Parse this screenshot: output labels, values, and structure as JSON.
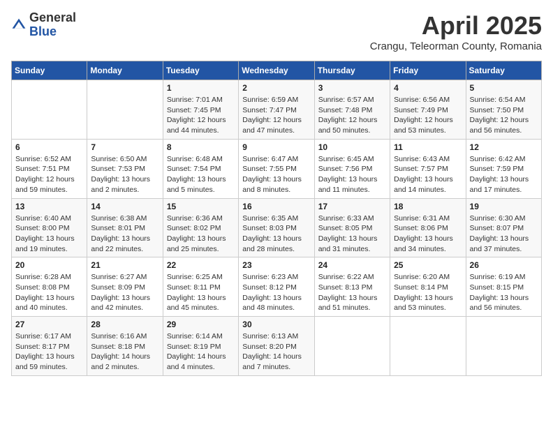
{
  "header": {
    "logo_general": "General",
    "logo_blue": "Blue",
    "month": "April 2025",
    "location": "Crangu, Teleorman County, Romania"
  },
  "weekdays": [
    "Sunday",
    "Monday",
    "Tuesday",
    "Wednesday",
    "Thursday",
    "Friday",
    "Saturday"
  ],
  "weeks": [
    [
      {
        "day": "",
        "info": ""
      },
      {
        "day": "",
        "info": ""
      },
      {
        "day": "1",
        "info": "Sunrise: 7:01 AM\nSunset: 7:45 PM\nDaylight: 12 hours and 44 minutes."
      },
      {
        "day": "2",
        "info": "Sunrise: 6:59 AM\nSunset: 7:47 PM\nDaylight: 12 hours and 47 minutes."
      },
      {
        "day": "3",
        "info": "Sunrise: 6:57 AM\nSunset: 7:48 PM\nDaylight: 12 hours and 50 minutes."
      },
      {
        "day": "4",
        "info": "Sunrise: 6:56 AM\nSunset: 7:49 PM\nDaylight: 12 hours and 53 minutes."
      },
      {
        "day": "5",
        "info": "Sunrise: 6:54 AM\nSunset: 7:50 PM\nDaylight: 12 hours and 56 minutes."
      }
    ],
    [
      {
        "day": "6",
        "info": "Sunrise: 6:52 AM\nSunset: 7:51 PM\nDaylight: 12 hours and 59 minutes."
      },
      {
        "day": "7",
        "info": "Sunrise: 6:50 AM\nSunset: 7:53 PM\nDaylight: 13 hours and 2 minutes."
      },
      {
        "day": "8",
        "info": "Sunrise: 6:48 AM\nSunset: 7:54 PM\nDaylight: 13 hours and 5 minutes."
      },
      {
        "day": "9",
        "info": "Sunrise: 6:47 AM\nSunset: 7:55 PM\nDaylight: 13 hours and 8 minutes."
      },
      {
        "day": "10",
        "info": "Sunrise: 6:45 AM\nSunset: 7:56 PM\nDaylight: 13 hours and 11 minutes."
      },
      {
        "day": "11",
        "info": "Sunrise: 6:43 AM\nSunset: 7:57 PM\nDaylight: 13 hours and 14 minutes."
      },
      {
        "day": "12",
        "info": "Sunrise: 6:42 AM\nSunset: 7:59 PM\nDaylight: 13 hours and 17 minutes."
      }
    ],
    [
      {
        "day": "13",
        "info": "Sunrise: 6:40 AM\nSunset: 8:00 PM\nDaylight: 13 hours and 19 minutes."
      },
      {
        "day": "14",
        "info": "Sunrise: 6:38 AM\nSunset: 8:01 PM\nDaylight: 13 hours and 22 minutes."
      },
      {
        "day": "15",
        "info": "Sunrise: 6:36 AM\nSunset: 8:02 PM\nDaylight: 13 hours and 25 minutes."
      },
      {
        "day": "16",
        "info": "Sunrise: 6:35 AM\nSunset: 8:03 PM\nDaylight: 13 hours and 28 minutes."
      },
      {
        "day": "17",
        "info": "Sunrise: 6:33 AM\nSunset: 8:05 PM\nDaylight: 13 hours and 31 minutes."
      },
      {
        "day": "18",
        "info": "Sunrise: 6:31 AM\nSunset: 8:06 PM\nDaylight: 13 hours and 34 minutes."
      },
      {
        "day": "19",
        "info": "Sunrise: 6:30 AM\nSunset: 8:07 PM\nDaylight: 13 hours and 37 minutes."
      }
    ],
    [
      {
        "day": "20",
        "info": "Sunrise: 6:28 AM\nSunset: 8:08 PM\nDaylight: 13 hours and 40 minutes."
      },
      {
        "day": "21",
        "info": "Sunrise: 6:27 AM\nSunset: 8:09 PM\nDaylight: 13 hours and 42 minutes."
      },
      {
        "day": "22",
        "info": "Sunrise: 6:25 AM\nSunset: 8:11 PM\nDaylight: 13 hours and 45 minutes."
      },
      {
        "day": "23",
        "info": "Sunrise: 6:23 AM\nSunset: 8:12 PM\nDaylight: 13 hours and 48 minutes."
      },
      {
        "day": "24",
        "info": "Sunrise: 6:22 AM\nSunset: 8:13 PM\nDaylight: 13 hours and 51 minutes."
      },
      {
        "day": "25",
        "info": "Sunrise: 6:20 AM\nSunset: 8:14 PM\nDaylight: 13 hours and 53 minutes."
      },
      {
        "day": "26",
        "info": "Sunrise: 6:19 AM\nSunset: 8:15 PM\nDaylight: 13 hours and 56 minutes."
      }
    ],
    [
      {
        "day": "27",
        "info": "Sunrise: 6:17 AM\nSunset: 8:17 PM\nDaylight: 13 hours and 59 minutes."
      },
      {
        "day": "28",
        "info": "Sunrise: 6:16 AM\nSunset: 8:18 PM\nDaylight: 14 hours and 2 minutes."
      },
      {
        "day": "29",
        "info": "Sunrise: 6:14 AM\nSunset: 8:19 PM\nDaylight: 14 hours and 4 minutes."
      },
      {
        "day": "30",
        "info": "Sunrise: 6:13 AM\nSunset: 8:20 PM\nDaylight: 14 hours and 7 minutes."
      },
      {
        "day": "",
        "info": ""
      },
      {
        "day": "",
        "info": ""
      },
      {
        "day": "",
        "info": ""
      }
    ]
  ]
}
